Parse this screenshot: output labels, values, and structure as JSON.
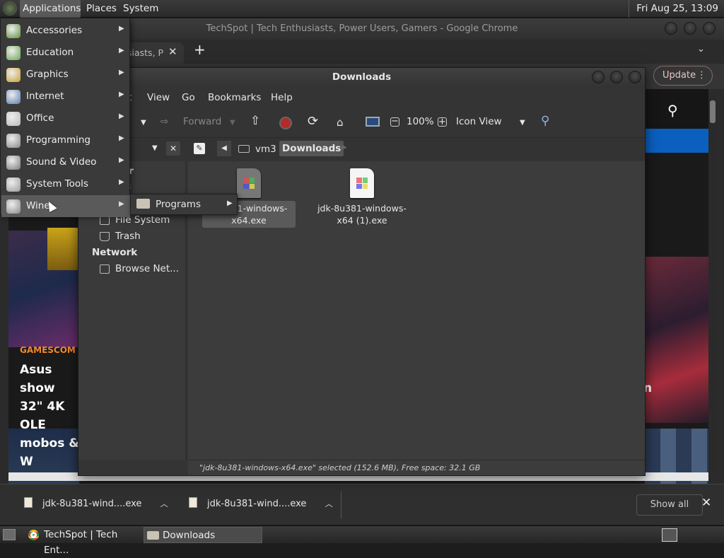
{
  "top_panel": {
    "applications": "Applications",
    "places": "Places",
    "system": "System",
    "clock": "Fri Aug 25, 13:09"
  },
  "chrome": {
    "window_title": "TechSpot | Tech Enthusiasts, Power Users, Gamers - Google Chrome",
    "tab_title": "siasts, P",
    "update_label": "Update"
  },
  "web": {
    "category": "GAMESCOM",
    "headline_lines": [
      "Asus show",
      "32\" 4K OLE",
      "mobos & W"
    ],
    "headline_right": "n"
  },
  "downloads_shelf": {
    "items": [
      "jdk-8u381-wind....exe",
      "jdk-8u381-wind....exe"
    ],
    "show_all": "Show all"
  },
  "taskbar": {
    "tasks": [
      "TechSpot | Tech Ent...",
      "Downloads"
    ]
  },
  "file_manager": {
    "title": "Downloads",
    "menus": [
      "t",
      "View",
      "Go",
      "Bookmarks",
      "Help"
    ],
    "toolbar": {
      "forward": "Forward",
      "zoom": "100%",
      "view_mode": "Icon View"
    },
    "path": [
      "vm3",
      "Downloads"
    ],
    "sidebar": {
      "partial_header": "er",
      "partial_item": "3",
      "items": [
        "File System",
        "Trash"
      ],
      "network_header": "Network",
      "network_items": [
        "Browse Net..."
      ]
    },
    "files": [
      {
        "label_lines": [
          "jdk-8u381-windows-",
          "x64.exe"
        ],
        "visible_label_lines": [
          "81-windows-",
          "x64.exe"
        ],
        "selected": true
      },
      {
        "label_lines": [
          "jdk-8u381-windows-",
          "x64 (1).exe"
        ],
        "selected": false
      }
    ],
    "status": "\"jdk-8u381-windows-x64.exe\" selected (152.6 MB), Free space: 32.1 GB"
  },
  "apps_menu": {
    "items": [
      {
        "label": "Accessories",
        "icon": "accessories-icon",
        "color": "#5f8f3f"
      },
      {
        "label": "Education",
        "icon": "education-icon",
        "color": "#6aa84f"
      },
      {
        "label": "Graphics",
        "icon": "graphics-icon",
        "color": "#c8a030"
      },
      {
        "label": "Internet",
        "icon": "internet-icon",
        "color": "#5a7fb0"
      },
      {
        "label": "Office",
        "icon": "office-icon",
        "color": "#b8b8b8"
      },
      {
        "label": "Programming",
        "icon": "programming-icon",
        "color": "#888888"
      },
      {
        "label": "Sound & Video",
        "icon": "sound-video-icon",
        "color": "#7a7a7a"
      },
      {
        "label": "System Tools",
        "icon": "system-tools-icon",
        "color": "#9a9a9a"
      },
      {
        "label": "Wine",
        "icon": "wine-icon",
        "color": "#8a8a8a"
      }
    ],
    "wine_submenu": [
      "Programs"
    ]
  }
}
